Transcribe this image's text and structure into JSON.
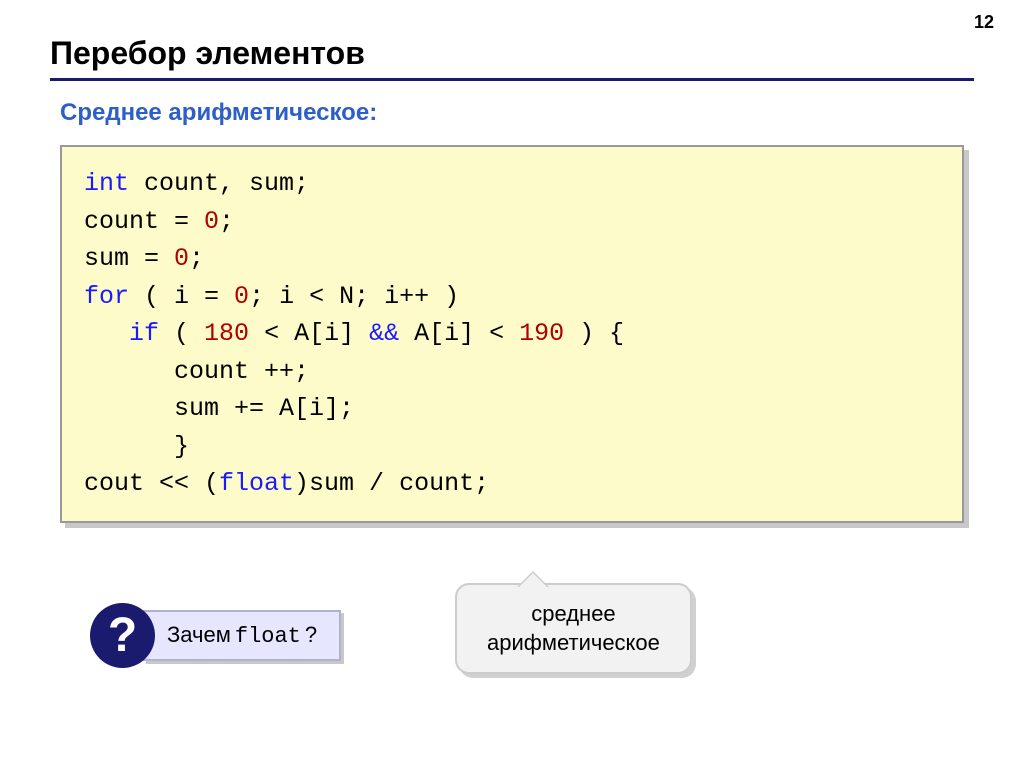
{
  "page_number": "12",
  "title": "Перебор элементов",
  "subtitle": "Среднее арифметическое:",
  "code": {
    "l1a": "int",
    "l1b": " count, sum;",
    "l2a": "count = ",
    "l2b": "0",
    "l2c": ";",
    "l3a": "sum = ",
    "l3b": "0",
    "l3c": ";",
    "l4a": "for",
    "l4b": " ( i = ",
    "l4c": "0",
    "l4d": "; i < N; i++ )",
    "l5a": "   ",
    "l5b": "if",
    "l5c": " ( ",
    "l5d": "180",
    "l5e": " < A[i] ",
    "l5f": "&&",
    "l5g": " A[i] < ",
    "l5h": "190",
    "l5i": " ) {",
    "l6": "      count ++;",
    "l7": "      sum += A[i];",
    "l8": "      }",
    "l9a": "cout << (",
    "l9b": "float",
    "l9c": ")sum / count;"
  },
  "question": {
    "mark": "?",
    "prefix": "Зачем ",
    "code": "float",
    "suffix": "?"
  },
  "bubble": {
    "line1": "среднее",
    "line2": "арифметическое"
  }
}
